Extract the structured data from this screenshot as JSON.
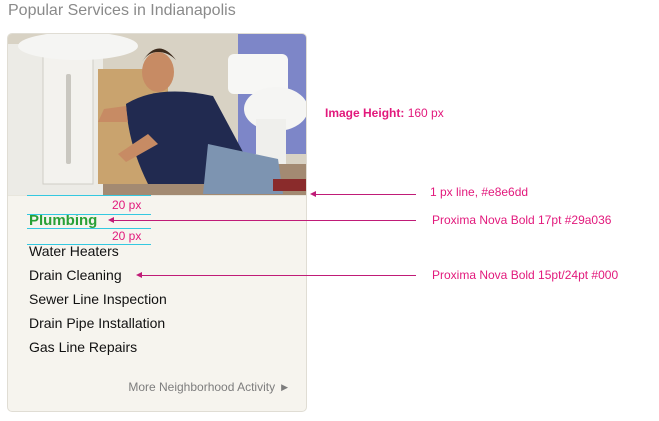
{
  "page": {
    "heading": "Popular Services in Indianapolis"
  },
  "card": {
    "category": "Plumbing",
    "services": [
      "Water Heaters",
      "Drain Cleaning",
      "Sewer Line Inspection",
      "Drain Pipe Installation",
      "Gas Line Repairs"
    ],
    "more_link": "More Neighborhood Activity",
    "more_icon": "triangle-right-icon"
  },
  "annotations": {
    "image_height_label": "Image Height:",
    "image_height_value": "160 px",
    "spacing_top": "20 px",
    "spacing_bottom": "20 px",
    "line_note": "1 px line, #e8e6dd",
    "category_font": "Proxima Nova Bold 17pt #29a036",
    "service_font": "Proxima Nova Bold 15pt/24pt #000"
  },
  "colors": {
    "category_green": "#29a036",
    "divider_line": "#e8e6dd",
    "annotation_pink": "#e2197c",
    "guide_cyan": "#34c8e0"
  }
}
